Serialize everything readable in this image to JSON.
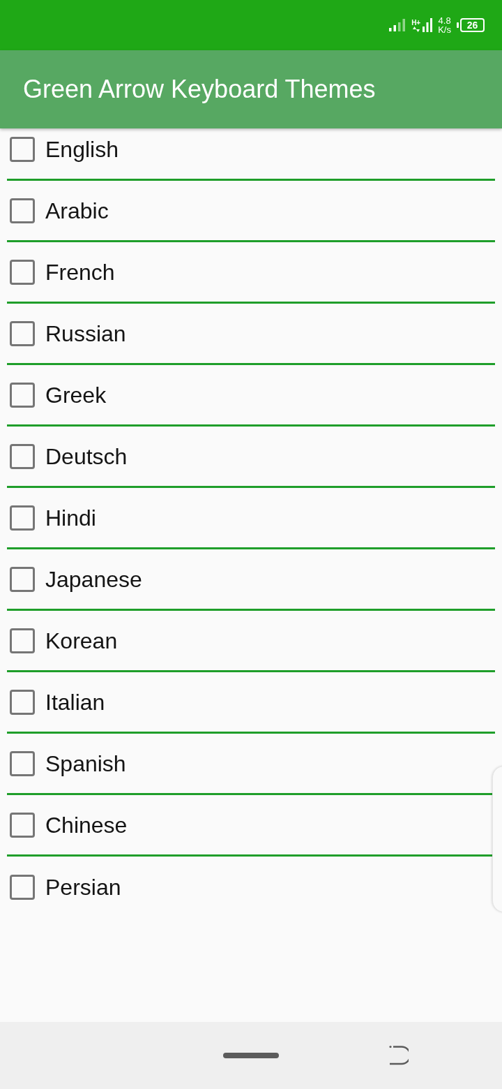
{
  "status_bar": {
    "network_type": "H+",
    "speed_value": "4.8",
    "speed_unit": "K/s",
    "battery": "26"
  },
  "app_bar": {
    "title": "Green Arrow Keyboard Themes"
  },
  "items": [
    {
      "label": "English",
      "checked": false
    },
    {
      "label": "Arabic",
      "checked": false
    },
    {
      "label": "French",
      "checked": false
    },
    {
      "label": "Russian",
      "checked": false
    },
    {
      "label": "Greek",
      "checked": false
    },
    {
      "label": "Deutsch",
      "checked": false
    },
    {
      "label": "Hindi",
      "checked": false
    },
    {
      "label": "Japanese",
      "checked": false
    },
    {
      "label": "Korean",
      "checked": false
    },
    {
      "label": "Italian",
      "checked": false
    },
    {
      "label": "Spanish",
      "checked": false
    },
    {
      "label": "Chinese",
      "checked": false
    },
    {
      "label": "Persian",
      "checked": false
    }
  ]
}
